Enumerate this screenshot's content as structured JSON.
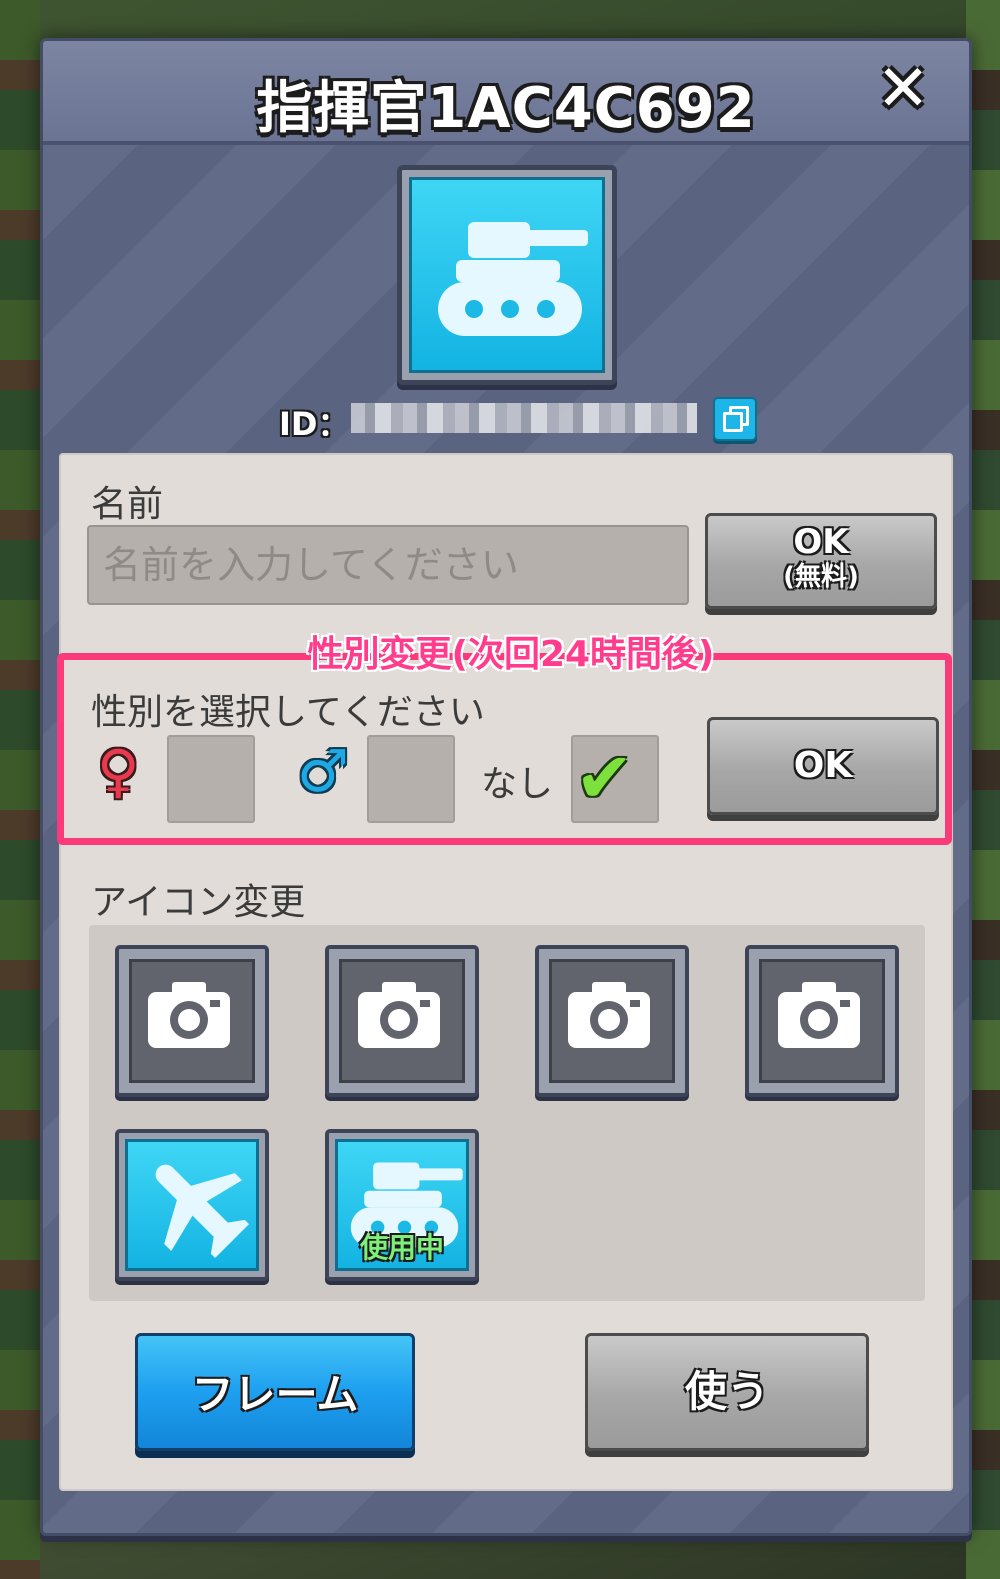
{
  "header": {
    "title": "指揮官1AC4C692",
    "close_icon": "close-icon"
  },
  "profile": {
    "avatar_icon": "tank-icon",
    "id_label": "ID：",
    "id_value": "",
    "copy_icon": "copy-icon"
  },
  "name_section": {
    "label": "名前",
    "placeholder": "名前を入力してください",
    "value": "",
    "ok_label": "OK",
    "ok_sublabel": "(無料)"
  },
  "gender_section": {
    "note": "性別変更(次回24時間後)",
    "prompt": "性別を選択してください",
    "female_symbol": "♀",
    "male_symbol": "♂",
    "none_label": "なし",
    "selected": "none",
    "check_symbol": "✔",
    "ok_label": "OK",
    "highlight_color": "#fb3a7b"
  },
  "icon_section": {
    "label": "アイコン変更",
    "icons": [
      {
        "icon": "camera-icon",
        "state": "empty"
      },
      {
        "icon": "camera-icon",
        "state": "empty"
      },
      {
        "icon": "camera-icon",
        "state": "empty"
      },
      {
        "icon": "camera-icon",
        "state": "empty"
      },
      {
        "icon": "airplane-icon",
        "state": "available"
      },
      {
        "icon": "tank-icon",
        "state": "in_use",
        "badge": "使用中"
      }
    ]
  },
  "buttons": {
    "frame_label": "フレーム",
    "use_label": "使う"
  },
  "colors": {
    "accent_blue": "#1e9ff0",
    "panel": "#5d6785",
    "content": "#e1dcd8",
    "in_use_green": "#7ef07a"
  }
}
